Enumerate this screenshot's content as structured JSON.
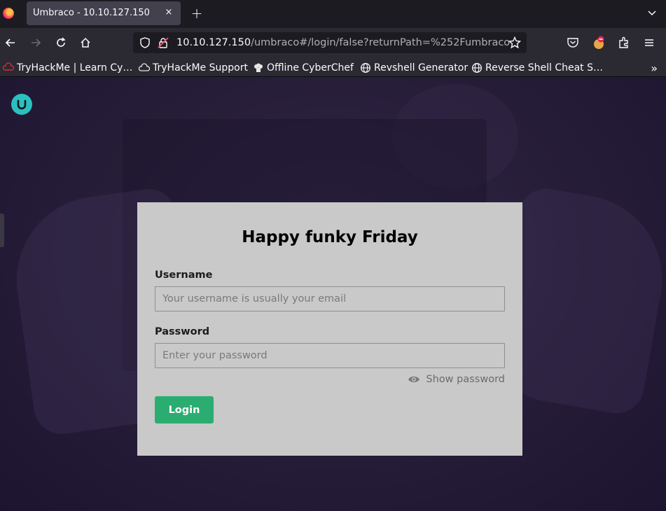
{
  "browser": {
    "tab": {
      "title": "Umbraco - 10.10.127.150",
      "close": "×"
    },
    "new_tab": "+",
    "url": {
      "host": "10.10.127.150",
      "path": "/umbraco#/login/false?returnPath=%252Fumbraco"
    },
    "bookmarks": [
      {
        "label": "TryHackMe | Learn Cy…",
        "icon": "tryhackme-icon"
      },
      {
        "label": "TryHackMe Support",
        "icon": "cloud-icon"
      },
      {
        "label": "Offline CyberChef",
        "icon": "chef-hat-icon"
      },
      {
        "label": "Revshell Generator",
        "icon": "globe-icon"
      },
      {
        "label": "Reverse Shell Cheat S…",
        "icon": "globe-icon"
      }
    ],
    "bookmarks_more": "»"
  },
  "login": {
    "title": "Happy funky Friday",
    "username_label": "Username",
    "username_placeholder": "Your username is usually your email",
    "username_value": "",
    "password_label": "Password",
    "password_placeholder": "Enter your password",
    "password_value": "",
    "show_password": "Show password",
    "login_button": "Login"
  },
  "colors": {
    "accent": "#2bad71",
    "card_bg": "#c9c9c9",
    "logo": "#2bc0bf",
    "browser_chrome": "#2b2a33"
  }
}
